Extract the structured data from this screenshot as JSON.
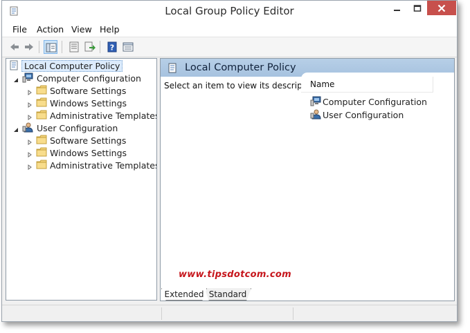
{
  "window": {
    "title": "Local Group Policy Editor",
    "caption_colors": {
      "close": "#c7504c"
    }
  },
  "menu": {
    "items": [
      "File",
      "Action",
      "View",
      "Help"
    ]
  },
  "toolbar": {
    "buttons": [
      "back-arrow-icon",
      "forward-arrow-icon",
      "show-hide-console-tree-icon",
      "properties-icon",
      "export-list-icon",
      "help-icon",
      "filter-view-icon"
    ]
  },
  "tree": {
    "root": "Local Computer Policy",
    "computer": {
      "label": "Computer Configuration",
      "children": [
        "Software Settings",
        "Windows Settings",
        "Administrative Templates"
      ]
    },
    "user": {
      "label": "User Configuration",
      "children": [
        "Software Settings",
        "Windows Settings",
        "Administrative Templates"
      ]
    }
  },
  "content": {
    "header_title": "Local Computer Policy",
    "description": "Select an item to view its description.",
    "column_name": "Name",
    "items": [
      "Computer Configuration",
      "User Configuration"
    ]
  },
  "watermark": "www.tipsdotcom.com",
  "tabs": {
    "extended": "Extended",
    "standard": "Standard"
  },
  "colors": {
    "selection": "#dcebfc",
    "header_band": "#a6c2df",
    "watermark": "#c6161c"
  }
}
